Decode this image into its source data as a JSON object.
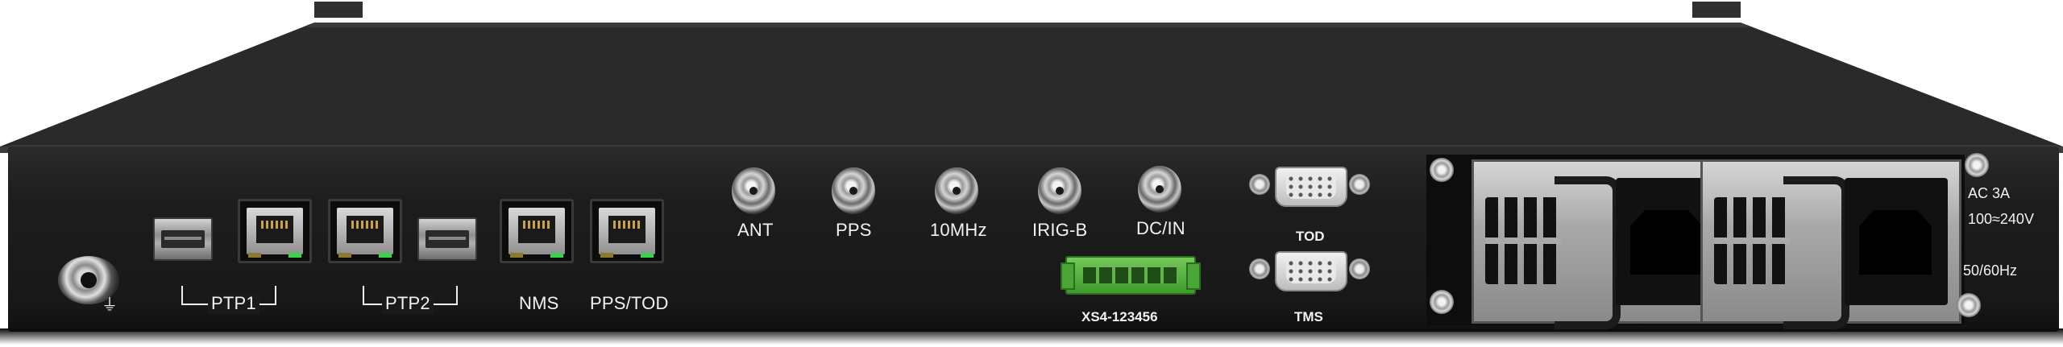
{
  "ports": {
    "ptp1": "PTP1",
    "ptp2": "PTP2",
    "nms": "NMS",
    "pps_tod": "PPS/TOD"
  },
  "bnc": {
    "ant": "ANT",
    "pps": "PPS",
    "mhz10": "10MHz",
    "irigb": "IRIG-B",
    "dcin": "DC/IN"
  },
  "serial": {
    "tod": "TOD",
    "tms": "TMS"
  },
  "terminal_block": {
    "label": "XS4-123456"
  },
  "power": {
    "ac": "AC  3A",
    "range": "100≈240V",
    "freq": "50/60Hz"
  },
  "icons": {
    "ground": "ground-symbol-icon"
  }
}
